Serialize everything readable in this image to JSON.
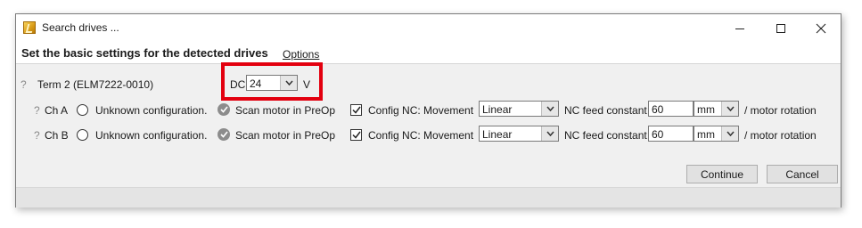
{
  "window": {
    "title": "Search drives ..."
  },
  "header": {
    "heading": "Set the basic settings for the detected drives",
    "options_link": "Options"
  },
  "terminal": {
    "help_mark": "?",
    "label": "Term 2 (ELM7222-0010)",
    "dc_prefix": "DC",
    "dc_value": "24",
    "dc_unit": "V"
  },
  "channels": [
    {
      "help_mark": "?",
      "label": "Ch A",
      "unknown_config_label": "Unknown configuration.",
      "scan_motor_label": "Scan motor in PreOp",
      "config_nc_label": "Config NC: Movement",
      "movement_value": "Linear",
      "nc_feed_label": "NC feed constant",
      "nc_feed_value": "60",
      "unit_value": "mm",
      "per_label": "/ motor rotation"
    },
    {
      "help_mark": "?",
      "label": "Ch B",
      "unknown_config_label": "Unknown configuration.",
      "scan_motor_label": "Scan motor in PreOp",
      "config_nc_label": "Config NC: Movement",
      "movement_value": "Linear",
      "nc_feed_label": "NC feed constant",
      "nc_feed_value": "60",
      "unit_value": "mm",
      "per_label": "/ motor rotation"
    }
  ],
  "buttons": {
    "continue_label": "Continue",
    "cancel_label": "Cancel"
  },
  "colors": {
    "highlight": "#e3000f",
    "window_bg": "#f0f0f0"
  },
  "icons": {
    "app": "app-icon",
    "minimize": "minimize-icon",
    "maximize": "maximize-icon",
    "close": "close-icon"
  }
}
